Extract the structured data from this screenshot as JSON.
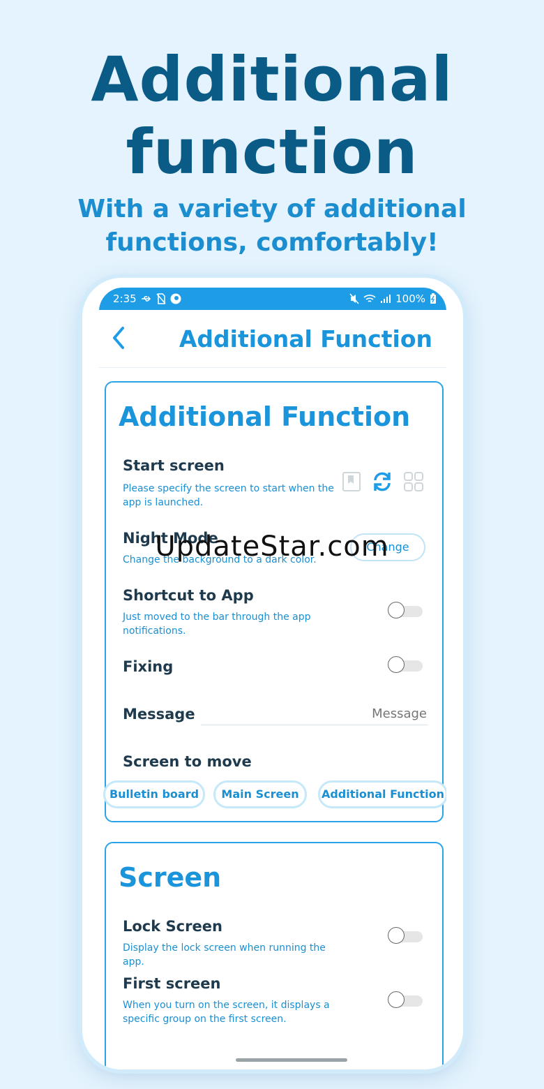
{
  "hero": {
    "title_line1": "Additional",
    "title_line2": "function",
    "subtitle_line1": "With a variety of additional",
    "subtitle_line2": "functions, comfortably!"
  },
  "status_bar": {
    "time": "2:35",
    "battery": "100%",
    "icons_left": [
      "usb-icon",
      "no-sim-icon",
      "app-notification-icon"
    ],
    "icons_right": [
      "mute-icon",
      "wifi-icon",
      "signal-icon",
      "battery-icon"
    ]
  },
  "app_bar": {
    "title": "Additional Function",
    "back_icon": "chevron-left-icon"
  },
  "additional_card": {
    "title": "Additional Function",
    "start_screen": {
      "title": "Start screen",
      "desc": "Please specify the screen to start when the app is launched.",
      "icons": [
        "bookmark-icon",
        "refresh-icon",
        "grid-icon"
      ]
    },
    "night_mode": {
      "title": "Night Mode",
      "desc": "Change the background to a dark color.",
      "button": "Change"
    },
    "shortcut": {
      "title": "Shortcut to App",
      "desc": "Just moved to the bar through the app notifications.",
      "enabled": false
    },
    "fixing": {
      "title": "Fixing",
      "enabled": false
    },
    "message": {
      "label": "Message",
      "placeholder": "Message"
    },
    "screen_to_move": {
      "title": "Screen to move",
      "chips": [
        "Bulletin board",
        "Main Screen",
        "Additional Function"
      ]
    }
  },
  "screen_card": {
    "title": "Screen",
    "lock_screen": {
      "title": "Lock Screen",
      "desc": "Display the lock screen when running the app.",
      "enabled": false
    },
    "first_screen": {
      "title": "First screen",
      "desc": "When you turn on the screen, it displays a specific group on the first screen.",
      "enabled": false
    }
  },
  "watermark": "UpdateStar.com",
  "colors": {
    "background": "#e4f3fd",
    "primary": "#1f9ce6",
    "hero_title": "#0b5b87",
    "card_border": "#2aa3e8"
  }
}
